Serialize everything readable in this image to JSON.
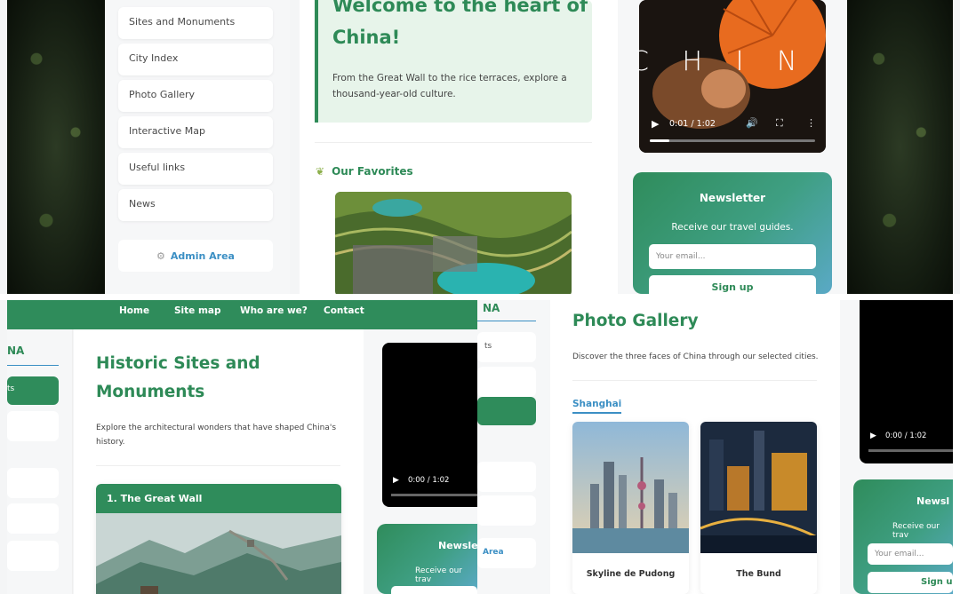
{
  "top_left": {
    "sidebar": [
      "Sites and Monuments",
      "City Index",
      "Photo Gallery",
      "Interactive Map",
      "Useful links",
      "News"
    ],
    "admin_label": "Admin Area",
    "hero_title_line1": "Welcome to the heart of",
    "hero_title_line2": "China!",
    "hero_text_line1": "From the Great Wall to the rice terraces, explore a",
    "hero_text_line2": "thousand-year-old culture.",
    "favorites_title": "Our Favorites",
    "video_overlay": "C H I N A",
    "video_time": "0:01 / 1:02",
    "newsletter_title": "Newsletter",
    "newsletter_text": "Receive our travel guides.",
    "email_placeholder": "Your email...",
    "signup_label": "Sign up"
  },
  "bottom_left": {
    "nav": [
      "Home",
      "Site map",
      "Who are we?",
      "Contact"
    ],
    "sidebar_heading": "NA",
    "sidebar_active": "ts",
    "title_line1": "Historic Sites and",
    "title_line2": "Monuments",
    "text_line1": "Explore the architectural wonders that have shaped China's",
    "text_line2": "history.",
    "card_title": "1. The Great Wall",
    "video_time": "0:00 / 1:02",
    "newsletter_partial": "Newslet",
    "newsletter_text_partial": "Receive our trav"
  },
  "bottom_right": {
    "sidebar_heading": "NA",
    "sidebar_item": "ts",
    "admin_partial": "Area",
    "title": "Photo Gallery",
    "subtitle": "Discover the three faces of China through our selected cities.",
    "tab": "Shanghai",
    "photos": [
      {
        "caption": "Skyline de Pudong"
      },
      {
        "caption": "The Bund"
      }
    ],
    "video_time": "0:00 / 1:02",
    "newsletter_partial": "Newsl",
    "newsletter_text_partial": "Receive our trav",
    "email_placeholder": "Your email...",
    "signup_partial": "Sign u"
  },
  "colors": {
    "accent": "#2e8a57",
    "link": "#3b8fc4",
    "light_green": "#e7f4ea"
  }
}
